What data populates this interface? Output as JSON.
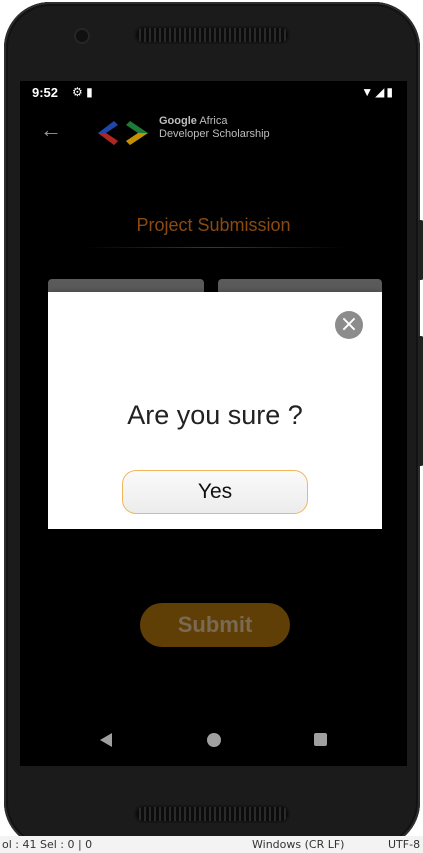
{
  "status_bar": {
    "time": "9:52",
    "left_icons": "⚙ ▮",
    "right_icons": "▼◢▮"
  },
  "app_bar": {
    "back_icon": "arrow-left-icon",
    "brand_line1_bold": "Google",
    "brand_line1_rest": "Africa",
    "brand_line2": "Developer Scholarship"
  },
  "page": {
    "title": "Project Submission",
    "submit_label": "Submit"
  },
  "dialog": {
    "message": "Are you sure ?",
    "yes_label": "Yes",
    "close_glyph": "×"
  },
  "ide_status": {
    "left": "ol : 41   Sel : 0 | 0",
    "middle": "Windows (CR LF)",
    "right": "UTF-8"
  },
  "colors": {
    "accent": "#8a4a10",
    "submit_bg": "#5f3f06",
    "yes_border": "#f0b85a",
    "close_bg": "#8c8c8c"
  }
}
